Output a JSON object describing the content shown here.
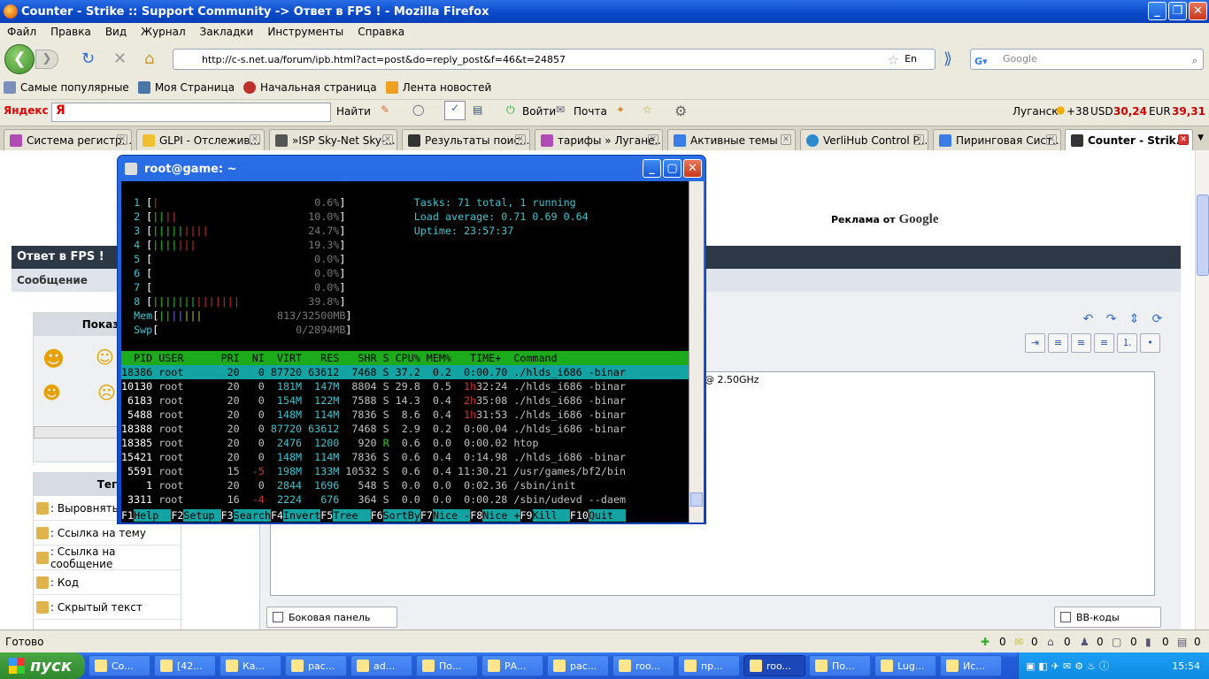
{
  "window": {
    "title": "Counter - Strike :: Support Community -> Ответ в FPS ! - Mozilla Firefox"
  },
  "menu": [
    "Файл",
    "Правка",
    "Вид",
    "Журнал",
    "Закладки",
    "Инструменты",
    "Справка"
  ],
  "nav": {
    "url": "http://c-s.net.ua/forum/ipb.html?act=post&do=reply_post&f=46&t=24857",
    "search_placeholder": "Google",
    "lang": "En"
  },
  "bookmarks": [
    "Самые популярные",
    "Моя Страница",
    "Начальная страница",
    "Лента новостей"
  ],
  "yandex": {
    "logo": "Яндекс",
    "find": "Найти",
    "login": "Войти",
    "mail": "Почта",
    "city": "Луганск",
    "temp": "+38",
    "usd_label": "USD",
    "usd": "30,24",
    "eur_label": "EUR",
    "eur": "39,31"
  },
  "tabs": [
    "Система регистр...",
    "GLPI - Отслежив...",
    "»ISP Sky-Net Sky-...",
    "Результаты поис...",
    "тарифы » Лугане...",
    "Активные темы",
    "VerliHub Control P...",
    "Пиринговая Сист...",
    "Counter - Strik..."
  ],
  "forum": {
    "header": "Ответ в FPS !",
    "sub": "Сообщение",
    "ad": "Реклама от",
    "ad_brand": "Google",
    "smilies_title": "Показат",
    "tags_title": "Тег",
    "tags": [
      ": Выровнять",
      ": Ссылка на тему",
      ": Ссылка на сообщение",
      ": Код",
      ": Скрытый текст"
    ],
    "cpu_text": "@ 2.50GHz",
    "sidebar_btn": "Боковая панель",
    "bbcode_btn": "BB-коды"
  },
  "status": {
    "text": "Готово",
    "counts": [
      "0",
      "0",
      "0",
      "0",
      "0",
      "0",
      "0"
    ]
  },
  "taskbar": {
    "start": "пуск",
    "items": [
      "Co...",
      "[42...",
      "Ка...",
      "рас...",
      "ad...",
      "По...",
      "РА...",
      "рас...",
      "roo...",
      "пр...",
      "roo...",
      "По...",
      "Lug...",
      "Ис..."
    ],
    "clock": "15:54"
  },
  "putty": {
    "title": "root@game: ~",
    "cpus": [
      {
        "n": "1",
        "pct": "0.6%",
        "bars": "|"
      },
      {
        "n": "2",
        "pct": "10.0%",
        "bars": "||||"
      },
      {
        "n": "3",
        "pct": "24.7%",
        "bars": "|||||||||"
      },
      {
        "n": "4",
        "pct": "19.3%",
        "bars": "|||||||"
      },
      {
        "n": "5",
        "pct": "0.0%",
        "bars": ""
      },
      {
        "n": "6",
        "pct": "0.0%",
        "bars": ""
      },
      {
        "n": "7",
        "pct": "0.0%",
        "bars": ""
      },
      {
        "n": "8",
        "pct": "39.8%",
        "bars": "||||||||||||||"
      }
    ],
    "mem": {
      "label": "Mem",
      "val": "813/32500MB",
      "bars": "|||||||"
    },
    "swp": {
      "label": "Swp",
      "val": "0/2894MB"
    },
    "tasks": "Tasks: 71 total, 1 running",
    "load": "Load average: 0.71 0.69 0.64",
    "uptime": "Uptime: 23:57:37",
    "columns": "  PID USER      PRI  NI  VIRT   RES   SHR S CPU% MEM%   TIME+  Command",
    "procs": [
      "18386 root       20   0 87720 63612  7468 S 37.2  0.2  0:00.70 ./hlds_i686 -binar",
      "10130 root       20   0  181M  147M  8804 S 29.8  0.5  1h32:24 ./hlds_i686 -binar",
      " 6183 root       20   0  154M  122M  7588 S 14.3  0.4  2h35:08 ./hlds_i686 -binar",
      " 5488 root       20   0  148M  114M  7836 S  8.6  0.4  1h31:53 ./hlds_i686 -binar",
      "18388 root       20   0 87720 63612  7468 S  2.9  0.2  0:00.04 ./hlds_i686 -binar",
      "18385 root       20   0  2476  1200   920 R  0.6  0.0  0:00.02 htop",
      "15421 root       20   0  148M  114M  7836 S  0.6  0.4  0:14.98 ./hlds_i686 -binar",
      " 5591 root       15  -5  198M  133M 10532 S  0.6  0.4 11:30.21 /usr/games/bf2/bin",
      "    1 root       20   0  2844  1696   548 S  0.0  0.0  0:02.36 /sbin/init",
      " 3311 root       16  -4  2224   676   364 S  0.0  0.0  0:00.28 /sbin/udevd --daem"
    ],
    "fkeys": [
      [
        "F1",
        "Help  "
      ],
      [
        "F2",
        "Setup "
      ],
      [
        "F3",
        "Search"
      ],
      [
        "F4",
        "Invert"
      ],
      [
        "F5",
        "Tree  "
      ],
      [
        "F6",
        "SortBy"
      ],
      [
        "F7",
        "Nice -"
      ],
      [
        "F8",
        "Nice +"
      ],
      [
        "F9",
        "Kill  "
      ],
      [
        "F10",
        "Quit  "
      ]
    ]
  }
}
